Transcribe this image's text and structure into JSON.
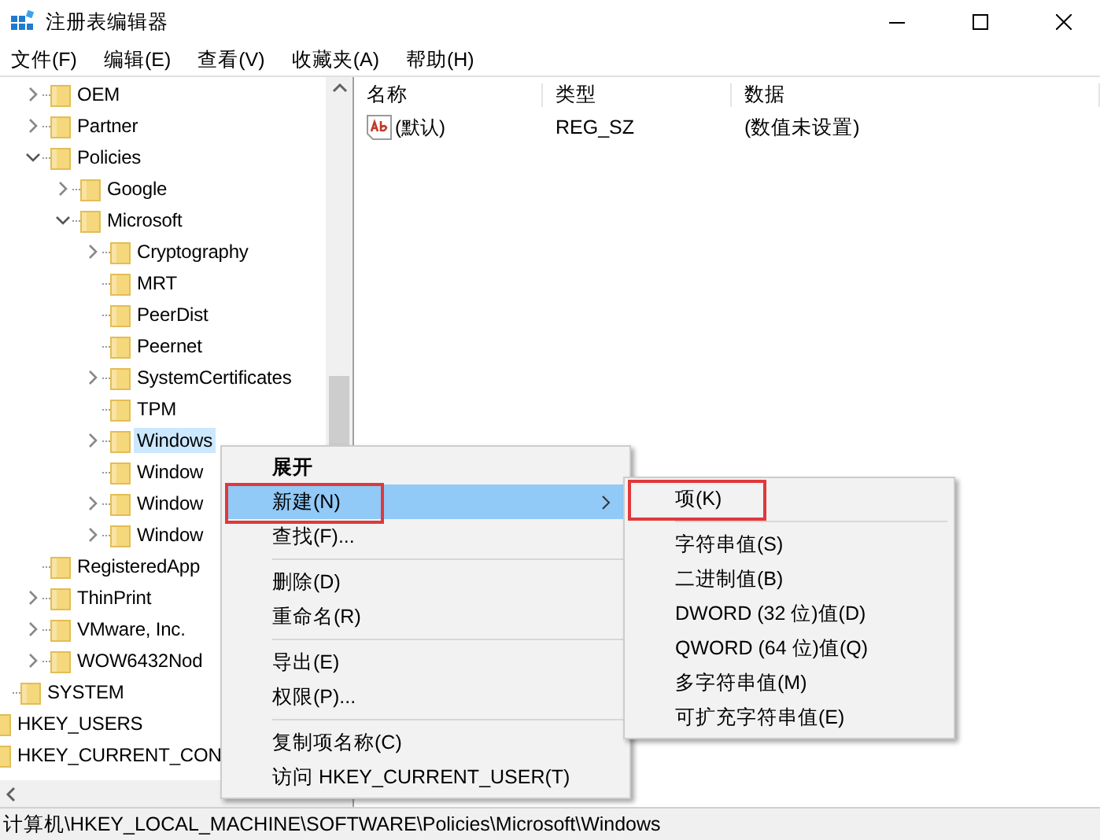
{
  "window": {
    "title": "注册表编辑器"
  },
  "menu_bar": [
    "文件(F)",
    "编辑(E)",
    "查看(V)",
    "收藏夹(A)",
    "帮助(H)"
  ],
  "tree": [
    {
      "children": [
        {
          "children": [
            {
              "label": "OEM",
              "expanded": false,
              "selected": false
            },
            {
              "label": "Partner",
              "expanded": false,
              "selected": false
            },
            {
              "label": "Policies",
              "expanded": true,
              "selected": false,
              "children": [
                {
                  "label": "Google",
                  "expanded": false,
                  "selected": false
                },
                {
                  "label": "Microsoft",
                  "expanded": true,
                  "selected": false,
                  "children": [
                    {
                      "label": "Cryptography",
                      "expanded": false,
                      "selected": false
                    },
                    {
                      "label": "MRT",
                      "selected": false
                    },
                    {
                      "label": "PeerDist",
                      "selected": false
                    },
                    {
                      "label": "Peernet",
                      "selected": false
                    },
                    {
                      "label": "SystemCertificates",
                      "expanded": false,
                      "selected": false
                    },
                    {
                      "label": "TPM",
                      "selected": false
                    },
                    {
                      "label": "Windows",
                      "expanded": false,
                      "selected": true
                    },
                    {
                      "label": "Window",
                      "selected": false
                    },
                    {
                      "label": "Window",
                      "expanded": false,
                      "selected": false
                    },
                    {
                      "label": "Window",
                      "expanded": false,
                      "selected": false
                    }
                  ]
                }
              ]
            },
            {
              "label": "RegisteredApp",
              "selected": false
            },
            {
              "label": "ThinPrint",
              "expanded": false,
              "selected": false
            },
            {
              "label": "VMware, Inc.",
              "expanded": false,
              "selected": false
            },
            {
              "label": "WOW6432Nod",
              "expanded": false,
              "selected": false
            }
          ]
        },
        {
          "label": "SYSTEM",
          "selected": false
        }
      ]
    },
    {
      "label": "HKEY_USERS",
      "selected": false
    },
    {
      "label": "HKEY_CURRENT_CON",
      "selected": false
    }
  ],
  "values_table": {
    "columns": [
      "名称",
      "类型",
      "数据"
    ],
    "rows": [
      {
        "name": "(默认)",
        "type": "REG_SZ",
        "data": "(数值未设置)"
      }
    ]
  },
  "context_menu": [
    {
      "kind": "item",
      "label": "展开",
      "default": true,
      "selected": false,
      "submenu": false,
      "annotated": false
    },
    {
      "kind": "item",
      "label": "新建(N)",
      "default": false,
      "selected": true,
      "submenu": true,
      "annotated": true
    },
    {
      "kind": "item",
      "label": "查找(F)...",
      "default": false,
      "selected": false,
      "submenu": false,
      "annotated": false
    },
    {
      "kind": "separator"
    },
    {
      "kind": "item",
      "label": "删除(D)",
      "default": false,
      "selected": false,
      "submenu": false,
      "annotated": false
    },
    {
      "kind": "item",
      "label": "重命名(R)",
      "default": false,
      "selected": false,
      "submenu": false,
      "annotated": false
    },
    {
      "kind": "separator"
    },
    {
      "kind": "item",
      "label": "导出(E)",
      "default": false,
      "selected": false,
      "submenu": false,
      "annotated": false
    },
    {
      "kind": "item",
      "label": "权限(P)...",
      "default": false,
      "selected": false,
      "submenu": false,
      "annotated": false
    },
    {
      "kind": "separator"
    },
    {
      "kind": "item",
      "label": "复制项名称(C)",
      "default": false,
      "selected": false,
      "submenu": false,
      "annotated": false
    },
    {
      "kind": "item",
      "label": "访问 HKEY_CURRENT_USER(T)",
      "default": false,
      "selected": false,
      "submenu": false,
      "annotated": false
    }
  ],
  "submenu": [
    {
      "kind": "item",
      "label": "项(K)",
      "annotated": true
    },
    {
      "kind": "separator"
    },
    {
      "kind": "item",
      "label": "字符串值(S)",
      "annotated": false
    },
    {
      "kind": "item",
      "label": "二进制值(B)",
      "annotated": false
    },
    {
      "kind": "item",
      "label": "DWORD (32 位)值(D)",
      "annotated": false
    },
    {
      "kind": "item",
      "label": "QWORD (64 位)值(Q)",
      "annotated": false
    },
    {
      "kind": "item",
      "label": "多字符串值(M)",
      "annotated": false
    },
    {
      "kind": "item",
      "label": "可扩充字符串值(E)",
      "annotated": false
    }
  ],
  "status_bar": "计算机\\HKEY_LOCAL_MACHINE\\SOFTWARE\\Policies\\Microsoft\\Windows"
}
